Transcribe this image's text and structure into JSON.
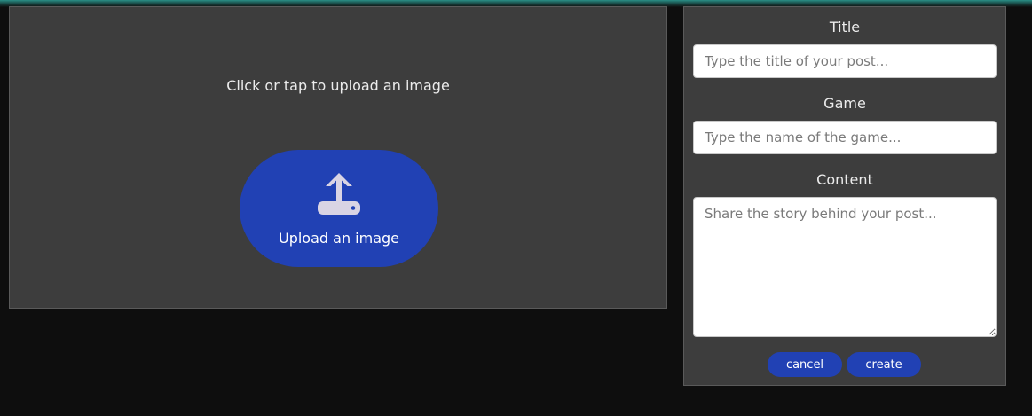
{
  "upload": {
    "prompt": "Click or tap to upload an image",
    "button_label": "Upload an image",
    "icon": "upload-tray-icon"
  },
  "form": {
    "title_label": "Title",
    "title_placeholder": "Type the title of your post...",
    "game_label": "Game",
    "game_placeholder": "Type the name of the game...",
    "content_label": "Content",
    "content_placeholder": "Share the story behind your post...",
    "cancel_label": "cancel",
    "create_label": "create"
  },
  "colors": {
    "accent": "#2141b4",
    "panel": "#3d3d3d",
    "background": "#0e0e0e",
    "top_glow": "#2a8f87"
  }
}
